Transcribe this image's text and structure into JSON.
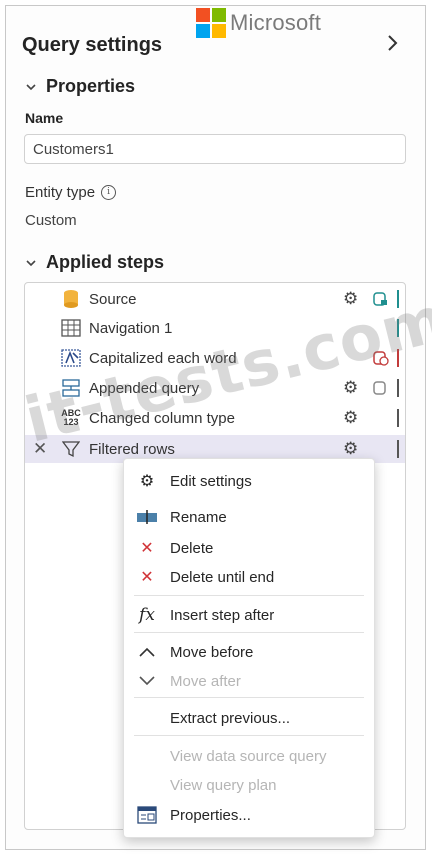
{
  "brand": {
    "name": "Microsoft",
    "colors": [
      "#f25022",
      "#7fba00",
      "#00a4ef",
      "#ffb900"
    ]
  },
  "panel": {
    "title": "Query settings",
    "collapse_icon": "chevron-right-icon"
  },
  "properties": {
    "heading": "Properties",
    "name_label": "Name",
    "name_value": "Customers1",
    "entity_type_label": "Entity type",
    "entity_type_value": "Custom"
  },
  "applied_steps": {
    "heading": "Applied steps",
    "steps": [
      {
        "label": "Source",
        "icon": "database-icon"
      },
      {
        "label": "Navigation 1",
        "icon": "table-grid-icon"
      },
      {
        "label": "Capitalized each word",
        "icon": "capitalize-icon"
      },
      {
        "label": "Appended query",
        "icon": "append-query-icon"
      },
      {
        "label": "Changed column type",
        "icon": "abc-123-icon",
        "icon_text_top": "ABC",
        "icon_text_bottom": "123"
      },
      {
        "label": "Filtered rows",
        "icon": "filter-icon"
      }
    ]
  },
  "context_menu": {
    "items": [
      {
        "label": "Edit settings",
        "icon": "gear-icon"
      },
      {
        "label": "Rename",
        "icon": "rename-icon"
      },
      {
        "label": "Delete",
        "icon": "close-icon"
      },
      {
        "label": "Delete until end",
        "icon": "close-icon"
      },
      {
        "label": "Insert step after",
        "icon": "fx-icon",
        "icon_text": "fx"
      },
      {
        "label": "Move before",
        "icon": "chevron-up-icon"
      },
      {
        "label": "Move after",
        "icon": "chevron-down-icon"
      },
      {
        "label": "Extract previous...",
        "icon": ""
      },
      {
        "label": "View data source query",
        "icon": ""
      },
      {
        "label": "View query plan",
        "icon": ""
      },
      {
        "label": "Properties...",
        "icon": "properties-icon"
      }
    ]
  },
  "watermark": "it-tests.com",
  "colors": {
    "accent_teal": "#1f8f8f",
    "delete_red": "#d13438",
    "selected_row": "#e8e6f3",
    "warning_red": "#c23b3b"
  }
}
